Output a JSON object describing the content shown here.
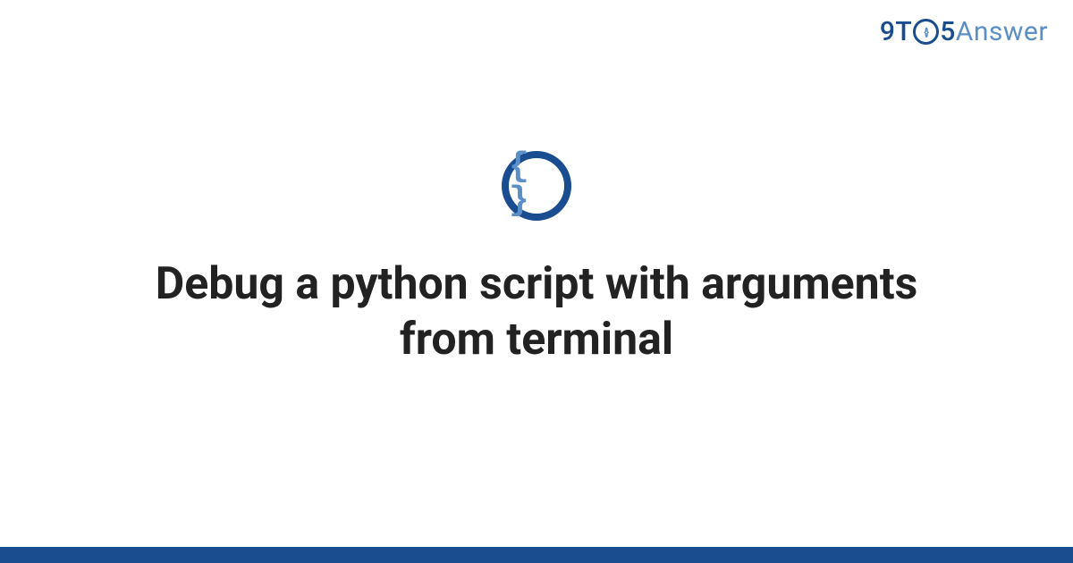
{
  "brand": {
    "part1": "9T",
    "part2_inner": "{}",
    "part3": "5",
    "part4": "Answer"
  },
  "icon": {
    "braces": "{ }"
  },
  "headline": "Debug a python script with arguments from terminal"
}
